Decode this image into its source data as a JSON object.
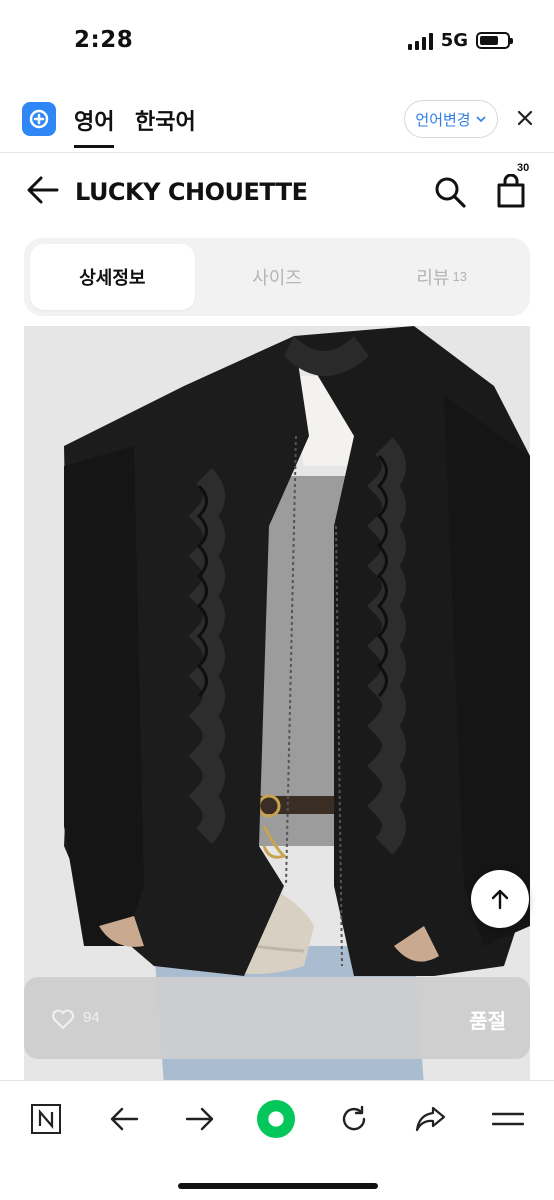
{
  "status": {
    "time": "2:28",
    "network": "5G"
  },
  "translate": {
    "tab_english": "영어",
    "tab_korean": "한국어",
    "change_language": "언어변경"
  },
  "header": {
    "title": "LUCKY CHOUETTE",
    "cart_count": "30"
  },
  "tabs": [
    {
      "label": "상세정보",
      "active": true
    },
    {
      "label": "사이즈",
      "active": false
    },
    {
      "label": "리뷰",
      "count": "13",
      "active": false
    }
  ],
  "action_bar": {
    "like_count": "94",
    "status_label": "품절"
  },
  "colors": {
    "accent_blue": "#2f86f5",
    "naver_green": "#03c75a",
    "jacket": "#1b1b1b"
  },
  "icons": [
    "back-arrow-icon",
    "search-icon",
    "shopping-bag-icon",
    "heart-icon",
    "arrow-up-icon",
    "naver-n-icon",
    "browser-back-icon",
    "browser-forward-icon",
    "green-dot-icon",
    "refresh-icon",
    "share-icon",
    "menu-icon",
    "close-icon",
    "chevron-down-icon"
  ]
}
